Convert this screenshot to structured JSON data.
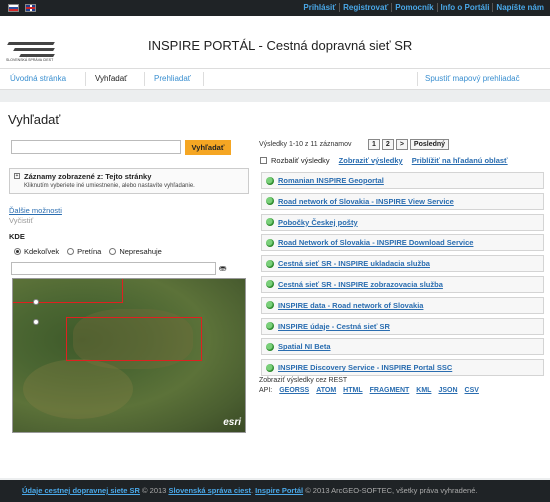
{
  "topbar": {
    "links": [
      "Prihlásiť",
      "Registrovať",
      "Pomocník",
      "Info o Portáli",
      "Napíšte nám"
    ]
  },
  "header": {
    "logo_text": "SLOVENSKÁ SPRÁVA CIEST",
    "title": "INSPIRE PORTÁL - Cestná dopravná sieť SR"
  },
  "nav": {
    "tabs": [
      "Úvodná stránka",
      "Vyhľadať",
      "Prehliadať"
    ],
    "map_viewer": "Spustiť mapový prehliadač"
  },
  "search": {
    "heading": "Vyhľadať",
    "input_value": "",
    "button": "Vyhľadať",
    "records_title": "Záznamy zobrazené z: Tejto stránky",
    "records_hint": "Kliknutím vyberiete iné umiestnenie, alebo nastavíte vyhľadanie.",
    "more_options": "Ďalšie možnosti",
    "clear": "Vyčistiť",
    "where_label": "KDE",
    "radio_options": [
      "Kdekoľvek",
      "Pretína",
      "Nepresahuje"
    ],
    "selected_radio": "Kdekoľvek",
    "location_value": "",
    "esri": "esri"
  },
  "results": {
    "summary": "Výsledky 1-10 z 11 záznamov",
    "pages": [
      "1",
      "2",
      ">",
      "Posledný"
    ],
    "expand_label": "Rozbaliť výsledky",
    "show_results": "Zobraziť výsledky",
    "zoom_to_area": "Priblížiť na hľadanú oblasť",
    "items": [
      "Romanian INSPIRE Geoportal",
      "Road network of Slovakia - INSPIRE View Service",
      "Pobočky Českej pošty",
      "Road Network of Slovakia - INSPIRE Download Service",
      "Cestná sieť SR - INSPIRE ukladacia služba",
      "Cestná sieť SR - INSPIRE zobrazovacia služba",
      "INSPIRE data - Road network of Slovakia",
      "INSPIRE údaje - Cestná sieť SR",
      "Spatial NI Beta",
      "INSPIRE Discovery Service - INSPIRE Portal SSC"
    ],
    "rest_label": "Zobraziť výsledky cez REST",
    "api_label": "API:",
    "api_formats": [
      "GEORSS",
      "ATOM",
      "HTML",
      "FRAGMENT",
      "KML",
      "JSON",
      "CSV"
    ]
  },
  "footer": {
    "link1": "Údaje cestnej dopravnej siete SR",
    "copy1": " © 2013 ",
    "link2": "Slovenská správa ciest",
    "sep": ". ",
    "link3": "Inspire Portál",
    "copy2": " © 2013 ArcGEO-SOFTEC, všetky práva vyhradené."
  }
}
